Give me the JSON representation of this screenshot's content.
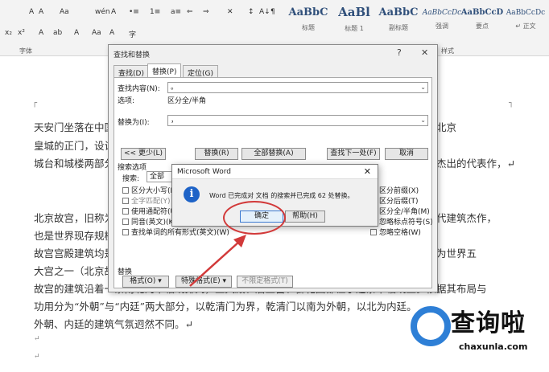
{
  "ribbon": {
    "row1": [
      "A",
      "A",
      "Aa",
      "wén",
      "A",
      "•≡",
      "1≡",
      "a≡",
      "⇐",
      "⇒",
      "✕",
      "↕",
      "A↓",
      "¶"
    ],
    "row2": [
      "x₂",
      "x²",
      "A",
      "ab",
      "A",
      "Aa",
      "A",
      "字"
    ],
    "font_group_label": "字体",
    "styles_group_label": "样式",
    "styles": [
      {
        "sample": "AaBbC",
        "caption": "标题"
      },
      {
        "sample": "AaBl",
        "caption": "标题 1"
      },
      {
        "sample": "AaBbC",
        "caption": "副标题"
      },
      {
        "sample": "AaBbCcDc",
        "caption": "强调"
      },
      {
        "sample": "AaBbCcD",
        "caption": "要点"
      },
      {
        "sample": "AaBbCcDc",
        "caption": "↵ 正文"
      }
    ]
  },
  "document": {
    "lines": [
      "天安门坐落在中国北京市中心，故宫的南端，与天安门广场以及人民英雄纪念碑、明清两代北京",
      "皇城的正门，设计者为明代御用建筑匠师蒯祥。天安门城楼坐落在北京城的中轴线上，由",
      "城台和城楼两部分组成，是中国古代最雄伟、最典型的城门建筑之一，是中国古代城门中最杰出的代表作，↵",
      "北京故宫，旧称为紫禁城，位于北京中轴线的中心，是中国明清两代的皇家宫殿，是中国古代建筑杰作，",
      "也是世界现存规模最大、保存最为完整的木质结构古建筑之一。",
      "故宫宫殿建筑均是木结构、黄琉璃瓦顶、青白石底座，饰以金碧辉煌的彩画。北京故宫被誉为世界五",
      "大宫之一（北京故宫、法国凡尔赛宫、英国白金汉宫、美国白宫、俄罗斯克里姆林宫），↵",
      "故宫的建筑沿着一条南北向中轴线排列，三大殿、后三宫、御花园都位于这条中轴线上。依据其布局与",
      "功用分为“外朝”与“内廷”两大部分，以乾清门为界，乾清门以南为外朝，以北为内廷。",
      "外朝、内廷的建筑气氛迥然不同。↵",
      "↵",
      "↵"
    ]
  },
  "find_dialog": {
    "title": "查找和替换",
    "help": "?",
    "close": "✕",
    "tabs": [
      "查找(D)",
      "替换(P)",
      "定位(G)"
    ],
    "find_label": "查找内容(N):",
    "find_value": "。",
    "options_label": "选项:",
    "options_value": "区分全/半角",
    "replace_label": "替换为(I):",
    "replace_value": "，",
    "less_button": "<< 更少(L)",
    "replace_button": "替换(R)",
    "replace_all_button": "全部替换(A)",
    "find_next_button": "查找下一处(F)",
    "cancel_button": "取消",
    "search_options_label": "搜索选项",
    "search_label": "搜索:",
    "search_value": "全部",
    "checks_left": [
      "区分大小写(H)",
      "全字匹配(Y)",
      "使用通配符(U)",
      "同音(英文)(K)",
      "查找单词的所有形式(英文)(W)"
    ],
    "checks_right": [
      "区分前缀(X)",
      "区分后缀(T)",
      "区分全/半角(M)",
      "忽略标点符号(S)",
      "忽略空格(W)"
    ],
    "replace_section_label": "替换",
    "format_button": "格式(O) ▾",
    "special_button": "特殊格式(E) ▾",
    "no_format_button": "不限定格式(T)"
  },
  "message_box": {
    "title": "Microsoft Word",
    "close": "✕",
    "icon_glyph": "i",
    "text": "Word 已完成对 文档 的搜索并已完成 62 处替换。",
    "ok_button": "确定",
    "help_button": "帮助(H)"
  },
  "watermark": {
    "text": "查询啦",
    "url": "chaxunla.com"
  }
}
